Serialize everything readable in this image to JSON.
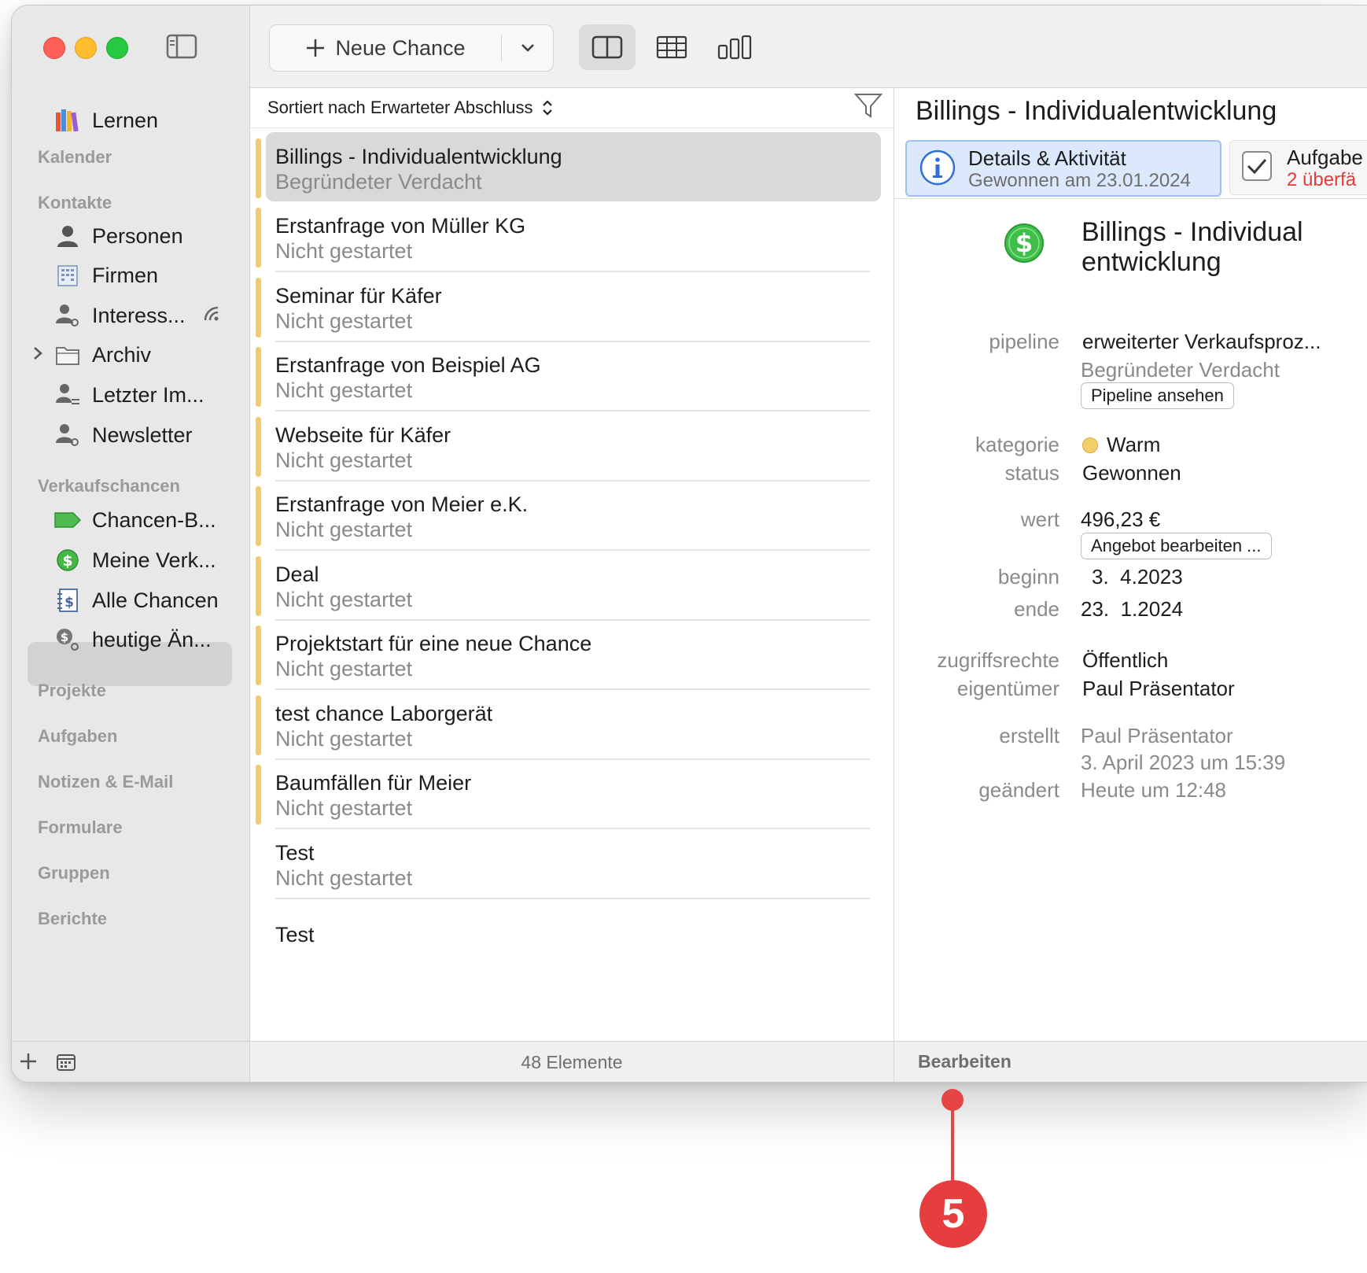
{
  "toolbar": {
    "new_label": "Neue Chance"
  },
  "sidebar": {
    "learn": "Lernen",
    "sections": {
      "kalender": "Kalender",
      "kontakte": "Kontakte",
      "verkaufschancen": "Verkaufschancen",
      "projekte": "Projekte",
      "aufgaben": "Aufgaben",
      "notizen": "Notizen & E-Mail",
      "formulare": "Formulare",
      "gruppen": "Gruppen",
      "berichte": "Berichte"
    },
    "contacts": [
      "Personen",
      "Firmen",
      "Interess...",
      "Archiv",
      "Letzter Im...",
      "Newsletter"
    ],
    "opportunities": [
      "Chancen-B...",
      "Meine Verk...",
      "Alle Chancen",
      "heutige Än..."
    ],
    "selected": "Alle Chancen"
  },
  "list": {
    "sort_label": "Sortiert nach Erwarteter Abschluss",
    "items": [
      {
        "title": "Billings - Individualentwicklung",
        "subtitle": "Begründeter Verdacht"
      },
      {
        "title": "Erstanfrage von Müller KG",
        "subtitle": "Nicht gestartet"
      },
      {
        "title": "Seminar für Käfer",
        "subtitle": "Nicht gestartet"
      },
      {
        "title": "Erstanfrage von Beispiel AG",
        "subtitle": "Nicht gestartet"
      },
      {
        "title": "Webseite für Käfer",
        "subtitle": "Nicht gestartet"
      },
      {
        "title": "Erstanfrage von Meier e.K.",
        "subtitle": "Nicht gestartet"
      },
      {
        "title": "Deal",
        "subtitle": "Nicht gestartet"
      },
      {
        "title": "Projektstart für eine neue Chance",
        "subtitle": "Nicht gestartet"
      },
      {
        "title": "test chance Laborgerät",
        "subtitle": "Nicht gestartet"
      },
      {
        "title": "Baumfällen für Meier",
        "subtitle": "Nicht gestartet"
      },
      {
        "title": "Test",
        "subtitle": "Nicht gestartet"
      },
      {
        "title": "Test",
        "subtitle": ""
      }
    ],
    "footer": "48 Elemente"
  },
  "detail": {
    "header_title": "Billings - Individualentwicklung",
    "tab1_title": "Details & Aktivität",
    "tab1_sub": "Gewonnen am 23.01.2024",
    "tab2_title": "Aufgabe",
    "tab2_sub": "2 überfä",
    "name": "Billings - Individualentwicklung",
    "labels": {
      "pipeline": "pipeline",
      "kategorie": "kategorie",
      "status": "status",
      "wert": "wert",
      "beginn": "beginn",
      "ende": "ende",
      "zugriffsrechte": "zugriffsrechte",
      "eigentuemer": "eigentümer",
      "erstellt": "erstellt",
      "geaendert": "geändert"
    },
    "values": {
      "pipeline": "erweiterter Verkaufsproz...",
      "pipeline_stage": "Begründeter Verdacht",
      "pipeline_button": "Pipeline ansehen",
      "kategorie": "Warm",
      "kategorie_color": "#f5d06a",
      "status": "Gewonnen",
      "wert": "496,23 €",
      "wert_button": "Angebot bearbeiten ...",
      "beginn": "3.  4.2023",
      "ende": "23.  1.2024",
      "zugriffsrechte": "Öffentlich",
      "eigentuemer": "Paul Präsentator",
      "erstellt_by": "Paul Präsentator",
      "erstellt_at": "3. April 2023 um 15:39",
      "geaendert": "Heute um 12:48"
    },
    "footer": "Bearbeiten"
  },
  "callout": {
    "number": "5",
    "color": "#e63e3e"
  }
}
